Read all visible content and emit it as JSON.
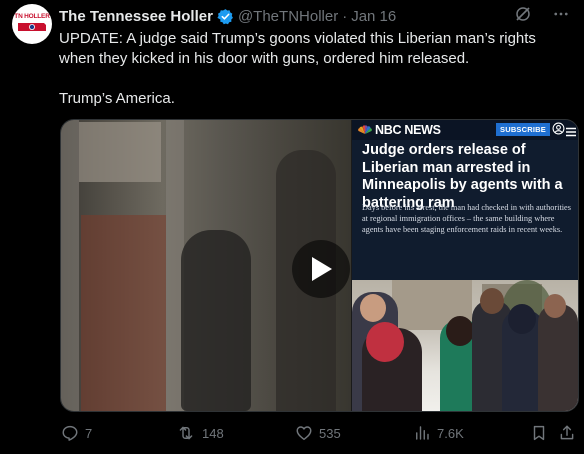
{
  "author": {
    "display_name": "The Tennessee Holler",
    "handle": "@TheTNHoller",
    "separator": "·",
    "timestamp": "Jan 16",
    "avatar_text": "TN HOLLER",
    "verified": true
  },
  "post": {
    "text": "UPDATE: A judge said Trump’s goons violated this Liberian man’s rights when they kicked in his door with guns, ordered him released.\n\nTrump’s America."
  },
  "media": {
    "video": {
      "play_icon": "play-icon"
    },
    "news_card": {
      "brand": "NBC NEWS",
      "subscribe_label": "SUBSCRIBE",
      "headline": "Judge orders release of Liberian man arrested in Minneapolis by agents with a battering ram",
      "summary": "Days before his arrest, the man had checked in with authorities at regional immigration offices – the same building where agents have been staging enforcement raids in recent weeks."
    }
  },
  "actions": {
    "replies": "7",
    "reposts": "148",
    "likes": "535",
    "views": "7.6K"
  },
  "colors": {
    "background": "#000000",
    "text": "#e7e9ea",
    "secondary": "#71767b",
    "verified": "#1d9bf0",
    "nbc_card": "#101c2e",
    "subscribe": "#1f6fd1"
  }
}
